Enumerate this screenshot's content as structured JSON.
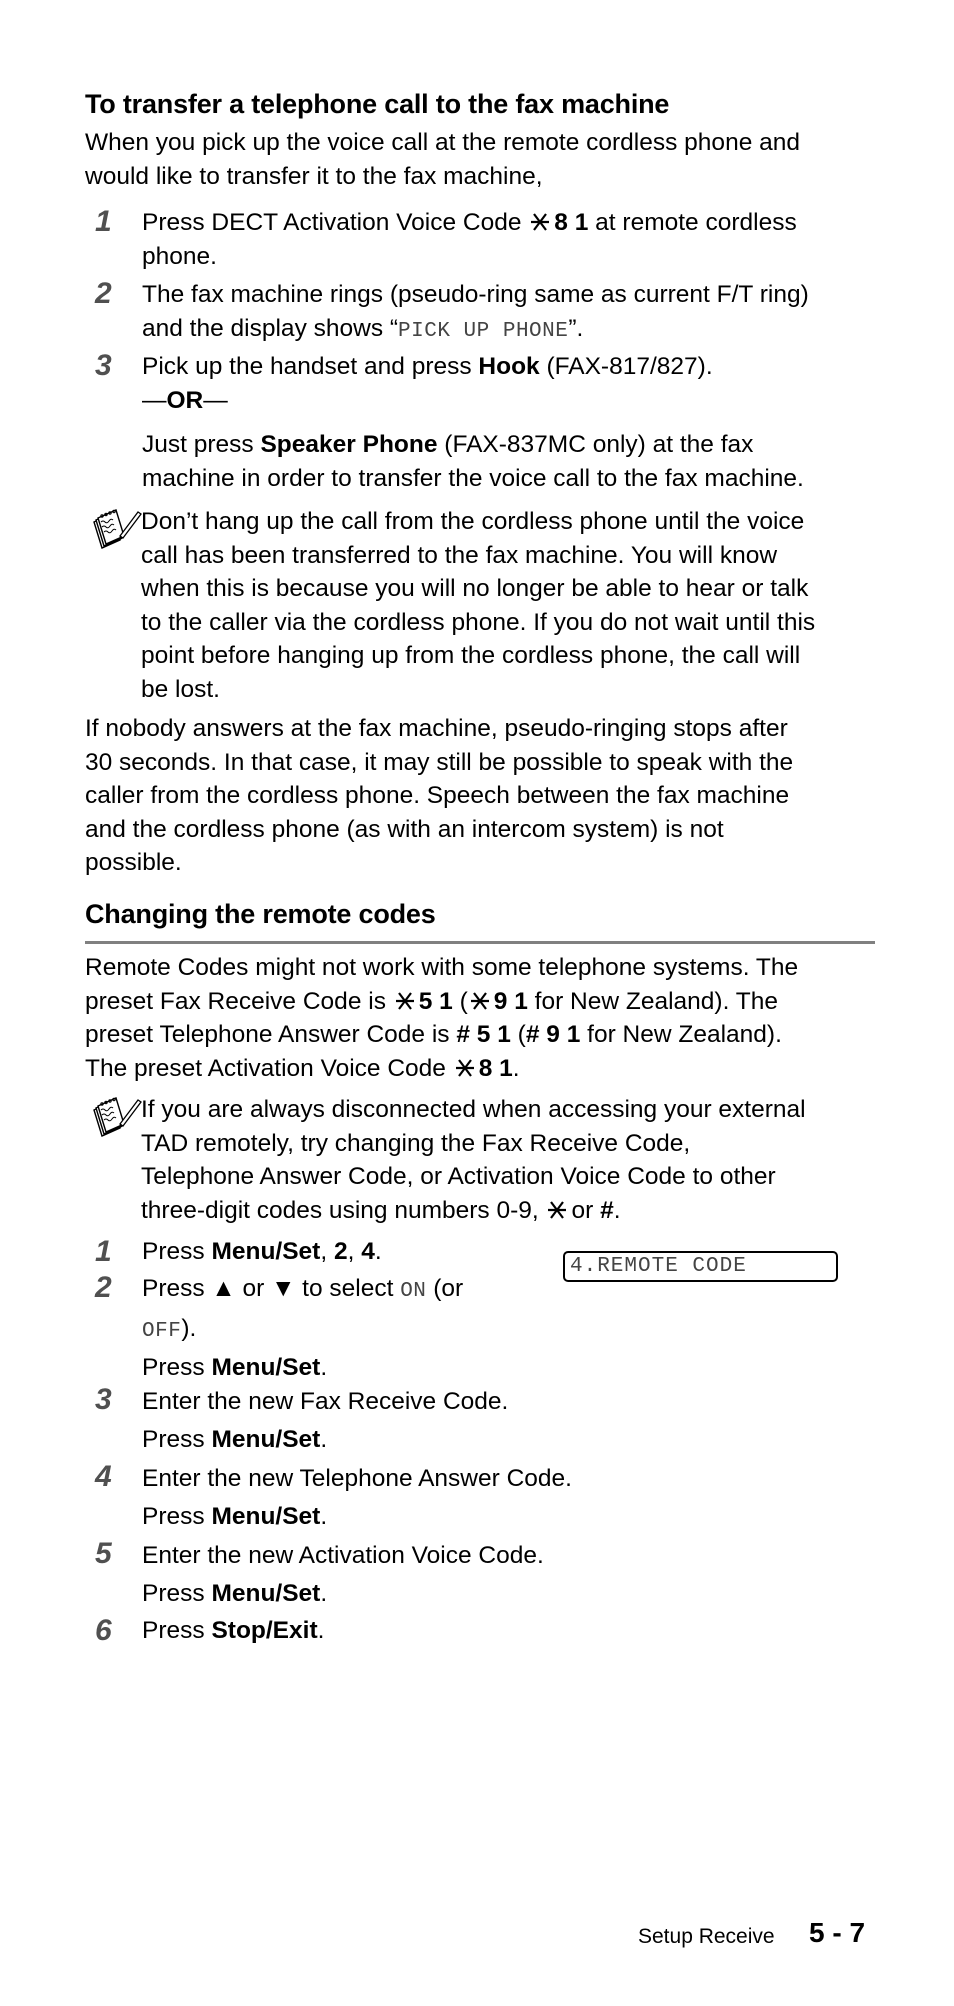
{
  "section1": {
    "title": "To transfer a telephone call to the fax machine",
    "intro": [
      [
        {
          "t": "When you pick up the voice call at the remote cordless phone and"
        }
      ],
      [
        {
          "t": "would like to transfer it to the fax machine,"
        }
      ]
    ],
    "steps": [
      {
        "num": "1",
        "lines": [
          [
            {
              "t": "Press DECT Activation Voice Code "
            },
            {
              "k": "star-key"
            },
            {
              "t": "8 1",
              "s": "b"
            },
            {
              "t": " at remote cordless"
            }
          ],
          [
            {
              "t": "phone."
            }
          ]
        ]
      },
      {
        "num": "2",
        "lines": [
          [
            {
              "t": "The fax machine rings (pseudo-ring same as current F/T ring)"
            }
          ],
          [
            {
              "t": "and the display shows “"
            },
            {
              "t": "PICK UP PHONE",
              "s": "m"
            },
            {
              "t": "”."
            }
          ]
        ]
      },
      {
        "num": "3",
        "lines": [
          [
            {
              "t": "Pick up the handset and press "
            },
            {
              "t": "Hook",
              "s": "b"
            },
            {
              "t": " (FAX-817/827)."
            }
          ],
          [
            {
              "t": "—"
            },
            {
              "t": "OR",
              "s": "b"
            },
            {
              "t": "—"
            }
          ]
        ]
      }
    ],
    "or_alt": [
      [
        {
          "t": "Just press "
        },
        {
          "t": "Speaker Phone",
          "s": "b"
        },
        {
          "t": " (FAX-837MC only) at the fax"
        }
      ],
      [
        {
          "t": "machine in order to transfer the voice call to the fax machine."
        }
      ]
    ],
    "note": [
      [
        {
          "t": "Don’t hang up the call from the cordless phone until the voice"
        }
      ],
      [
        {
          "t": "call has been transferred to the fax machine. You will know"
        }
      ],
      [
        {
          "t": "when this is because you will no longer be able to hear or talk"
        }
      ],
      [
        {
          "t": "to the caller via the cordless phone. If you do not wait until this"
        }
      ],
      [
        {
          "t": "point before hanging up from the cordless phone, the call will"
        }
      ],
      [
        {
          "t": "be lost."
        }
      ]
    ],
    "after": [
      [
        {
          "t": "If nobody answers at the fax machine, pseudo-ringing stops after"
        }
      ],
      [
        {
          "t": "30 seconds. In that case, it may still be possible to speak with the"
        }
      ],
      [
        {
          "t": "caller from the cordless phone. Speech between the fax machine"
        }
      ],
      [
        {
          "t": "and the cordless phone (as with an intercom system) is not"
        }
      ],
      [
        {
          "t": "possible."
        }
      ]
    ]
  },
  "section2": {
    "title": "Changing the remote codes",
    "intro": [
      [
        {
          "t": "Remote Codes might not work with some telephone systems. The"
        }
      ],
      [
        {
          "t": "preset Fax Receive Code is "
        },
        {
          "k": "star-key"
        },
        {
          "t": "5 1",
          "s": "b"
        },
        {
          "t": " ("
        },
        {
          "k": "star-key"
        },
        {
          "t": "9 1",
          "s": "b"
        },
        {
          "t": " for New Zealand). The"
        }
      ],
      [
        {
          "t": "preset Telephone Answer Code is "
        },
        {
          "t": "# 5 1",
          "s": "b"
        },
        {
          "t": " ("
        },
        {
          "t": "# 9 1",
          "s": "b"
        },
        {
          "t": " for New Zealand)."
        }
      ],
      [
        {
          "t": "The preset Activation Voice Code "
        },
        {
          "k": "star-key"
        },
        {
          "t": "8 1",
          "s": "b"
        },
        {
          "t": "."
        }
      ]
    ],
    "note": [
      [
        {
          "t": "If you are always disconnected when accessing your external"
        }
      ],
      [
        {
          "t": "TAD remotely, try changing the Fax Receive Code,"
        }
      ],
      [
        {
          "t": "Telephone Answer Code, or Activation Voice Code to other"
        }
      ],
      [
        {
          "t": "three-digit codes using numbers 0-9, "
        },
        {
          "k": "star-key"
        },
        {
          "t": "or "
        },
        {
          "t": "#",
          "s": "b"
        },
        {
          "t": "."
        }
      ]
    ],
    "lcd_display": "4.REMOTE CODE",
    "steps": [
      {
        "num": "1",
        "lines": [
          [
            {
              "t": "Press "
            },
            {
              "t": "Menu/Set",
              "s": "b"
            },
            {
              "t": ", "
            },
            {
              "t": "2",
              "s": "b"
            },
            {
              "t": ", "
            },
            {
              "t": "4",
              "s": "b"
            },
            {
              "t": "."
            }
          ]
        ]
      },
      {
        "num": "2",
        "lines": [
          [
            {
              "t": "Press ▲ or ▼ to select "
            },
            {
              "t": "ON",
              "s": "m"
            },
            {
              "t": " (or"
            }
          ],
          [
            {
              "t": "OFF",
              "s": "m"
            },
            {
              "t": ")."
            }
          ],
          [
            {
              "t": "Press "
            },
            {
              "t": "Menu/Set",
              "s": "b"
            },
            {
              "t": "."
            }
          ]
        ]
      },
      {
        "num": "3",
        "lines": [
          [
            {
              "t": "Enter the new Fax Receive Code."
            }
          ],
          [
            {
              "t": "Press "
            },
            {
              "t": "Menu/Set",
              "s": "b"
            },
            {
              "t": "."
            }
          ]
        ]
      },
      {
        "num": "4",
        "lines": [
          [
            {
              "t": "Enter the new Telephone Answer Code."
            }
          ],
          [
            {
              "t": "Press "
            },
            {
              "t": "Menu/Set",
              "s": "b"
            },
            {
              "t": "."
            }
          ]
        ]
      },
      {
        "num": "5",
        "lines": [
          [
            {
              "t": "Enter the new Activation Voice Code."
            }
          ],
          [
            {
              "t": "Press "
            },
            {
              "t": "Menu/Set",
              "s": "b"
            },
            {
              "t": "."
            }
          ]
        ]
      },
      {
        "num": "6",
        "lines": [
          [
            {
              "t": "Press "
            },
            {
              "t": "Stop/Exit",
              "s": "b"
            },
            {
              "t": "."
            }
          ]
        ]
      }
    ]
  },
  "footer": {
    "chapter": "Setup Receive",
    "page": "5 - 7"
  },
  "colors": {
    "text": "#000000",
    "step_number": "#505050",
    "rule": "#808080",
    "mono_text": "#444444"
  }
}
